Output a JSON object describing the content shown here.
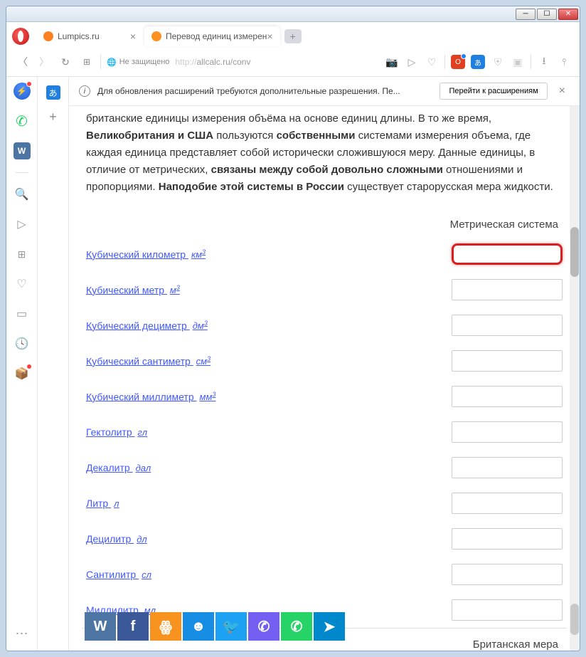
{
  "window": {
    "tabs": [
      {
        "title": "Lumpics.ru",
        "favicon": "#ff8020"
      },
      {
        "title": "Перевод единиц измерен",
        "favicon": "#ff9020"
      }
    ],
    "addr": {
      "secure_label": "Не защищено",
      "url_prefix": "http://",
      "url_rest": "allcalc.ru/conv"
    },
    "ext_banner": {
      "text": "Для обновления расширений требуются дополнительные разрешения. Пе...",
      "button": "Перейти к расширениям"
    }
  },
  "page": {
    "intro": {
      "t1": "британские единицы измерения объёма на основе единиц длины. В то же время, ",
      "b1": "Великобритания и США",
      "t2": " пользуются ",
      "b2": "собственными",
      "t3": " системами измерения объема, где каждая единица представляет собой исторически сложившуюся меру. Данные единицы, в отличие от метрических, ",
      "b3": "связаны между собой довольно сложными",
      "t4": " отношениями и пропорциями. ",
      "b4": "Наподобие этой системы в России",
      "t5": " существует старорусская мера жидкости."
    },
    "section1_title": "Метрическая система",
    "section2_title": "Британская мера",
    "units": [
      {
        "label": "Кубический километр",
        "sym": "км",
        "sup": "3",
        "hl": true
      },
      {
        "label": "Кубический метр",
        "sym": "м",
        "sup": "3"
      },
      {
        "label": "Кубический дециметр",
        "sym": "дм",
        "sup": "3"
      },
      {
        "label": "Кубический сантиметр",
        "sym": "см",
        "sup": "3"
      },
      {
        "label": "Кубический миллиметр",
        "sym": "мм",
        "sup": "3"
      },
      {
        "label": "Гектолитр",
        "sym": "гл",
        "sup": ""
      },
      {
        "label": "Декалитр",
        "sym": "дал",
        "sup": ""
      },
      {
        "label": "Литр",
        "sym": "л",
        "sup": ""
      },
      {
        "label": "Децилитр",
        "sym": "дл",
        "sup": ""
      },
      {
        "label": "Сантилитр",
        "sym": "сл",
        "sup": ""
      },
      {
        "label": "Миллилитр",
        "sym": "мл",
        "sup": ""
      }
    ],
    "social": [
      {
        "name": "vk",
        "color": "#4c75a3",
        "glyph": "W"
      },
      {
        "name": "facebook",
        "color": "#3b5998",
        "glyph": "f"
      },
      {
        "name": "ok",
        "color": "#f7931e",
        "glyph": "ꙮ"
      },
      {
        "name": "moi-mir",
        "color": "#168de2",
        "glyph": "☻"
      },
      {
        "name": "twitter",
        "color": "#1da1f2",
        "glyph": "🐦"
      },
      {
        "name": "viber",
        "color": "#7360f2",
        "glyph": "✆"
      },
      {
        "name": "whatsapp",
        "color": "#25d366",
        "glyph": "✆"
      },
      {
        "name": "telegram",
        "color": "#0088cc",
        "glyph": "➤"
      }
    ]
  }
}
